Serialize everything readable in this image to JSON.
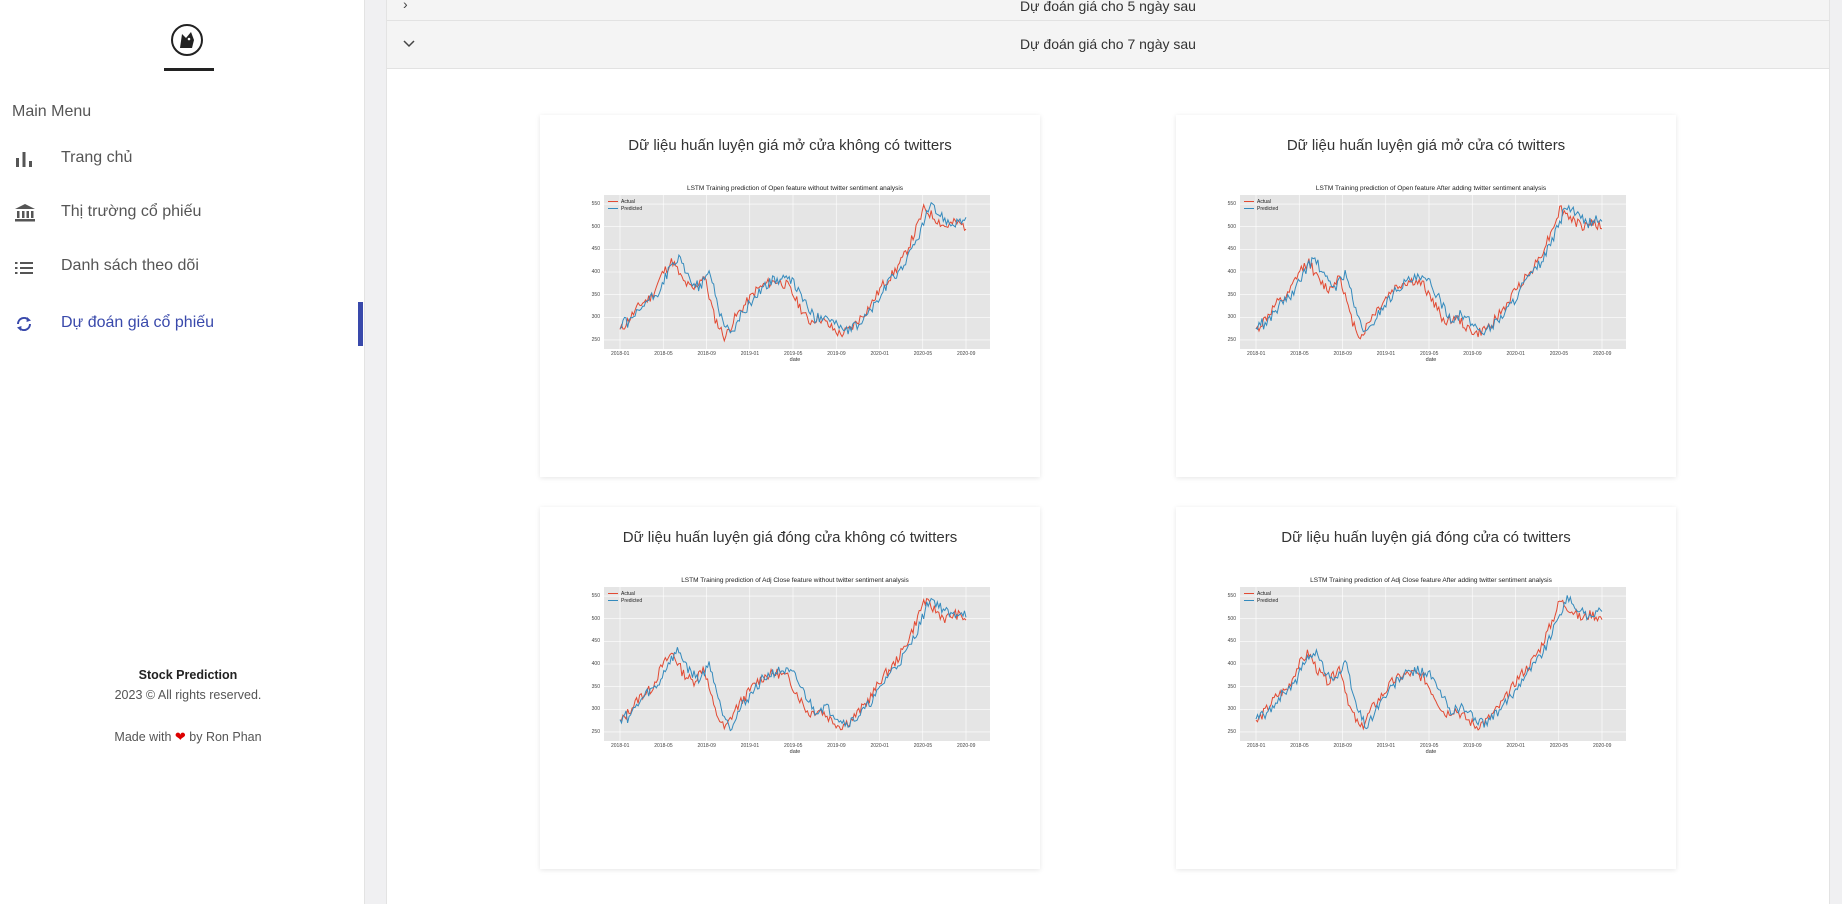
{
  "sidebar": {
    "menu_title": "Main Menu",
    "items": [
      {
        "label": "Trang chủ",
        "icon": "bar-chart-icon"
      },
      {
        "label": "Thị trường cổ phiếu",
        "icon": "bank-icon"
      },
      {
        "label": "Danh sách theo dõi",
        "icon": "list-icon"
      },
      {
        "label": "Dự đoán giá cổ phiếu",
        "icon": "sync-icon"
      }
    ],
    "active_color": "#3949ab",
    "footer": {
      "app_name": "Stock Prediction",
      "copyright": "2023 © All rights reserved.",
      "made_with": "Made with",
      "by": "by Ron Phan"
    }
  },
  "accordion": [
    {
      "title": "Dự đoán giá cho 5 ngày sau",
      "expanded": false
    },
    {
      "title": "Dự đoán giá cho 7 ngày sau",
      "expanded": true
    }
  ],
  "cards": [
    {
      "title": "Dữ liệu huấn luyện giá mở cửa không có twitters",
      "plot_title": "LSTM Training prediction of Open feature without twitter sentiment analysis"
    },
    {
      "title": "Dữ liệu huấn luyện giá mở cửa có twitters",
      "plot_title": "LSTM Training prediction of Open feature After adding twitter sentiment analysis"
    },
    {
      "title": "Dữ liệu huấn luyện giá đóng cửa không có twitters",
      "plot_title": "LSTM Training prediction of Adj Close feature without twitter sentiment analysis"
    },
    {
      "title": "Dữ liệu huấn luyện giá đóng cửa có twitters",
      "plot_title": "LSTM Training prediction of Adj Close feature After adding twitter sentiment analysis"
    }
  ],
  "chart_data": {
    "type": "line",
    "xlabel": "date",
    "ylabel": "",
    "x_ticks": [
      "2018-01",
      "2018-05",
      "2018-09",
      "2019-01",
      "2019-05",
      "2019-09",
      "2020-01",
      "2020-05",
      "2020-09"
    ],
    "y_ticks": [
      250,
      300,
      350,
      400,
      450,
      500,
      550
    ],
    "ylim": [
      230,
      570
    ],
    "legend": [
      "Actual",
      "Predicted"
    ],
    "colors": {
      "Actual": "#e24a33",
      "Predicted": "#348abd"
    },
    "grid": true
  }
}
